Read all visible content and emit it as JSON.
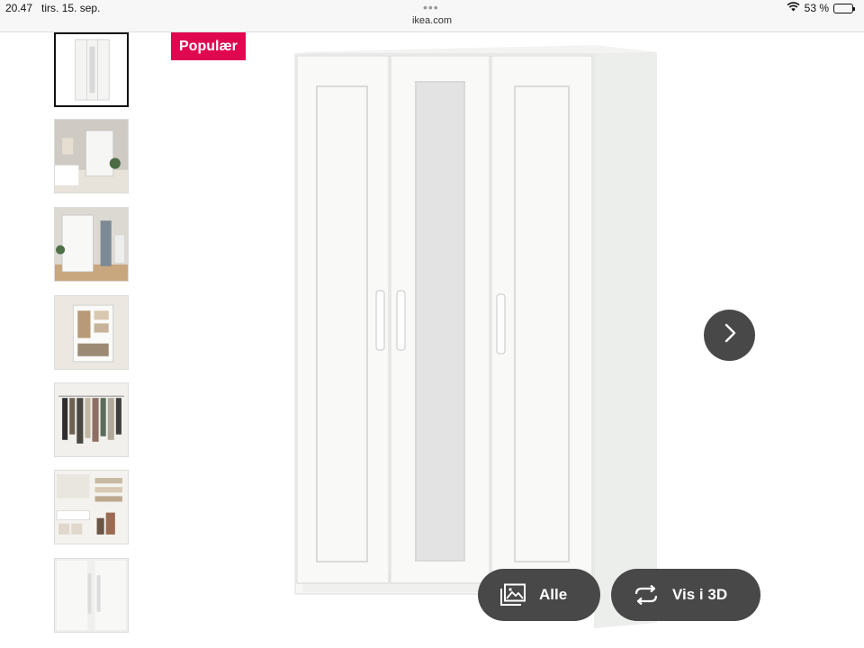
{
  "status_bar": {
    "time": "20.47",
    "date": "tirs. 15. sep.",
    "url": "ikea.com",
    "battery": "53 %",
    "battery_level": 0.53,
    "icons": [
      "wifi-icon",
      "battery-icon"
    ]
  },
  "badge": {
    "label": "Populær",
    "color": "#e00751"
  },
  "gallery": {
    "active_index": 0,
    "thumbnails": [
      "wardrobe-front",
      "bedroom-scene",
      "hallway-scene",
      "open-wardrobe-interior",
      "hanging-clothes",
      "shelves-with-boxes",
      "door-handles-closeup"
    ]
  },
  "controls": {
    "next_icon": "chevron-right-icon",
    "all_label": "Alle",
    "all_icon": "gallery-icon",
    "view_3d_label": "Vis i 3D",
    "view_3d_icon": "rotate-icon",
    "button_color": "#484848"
  }
}
